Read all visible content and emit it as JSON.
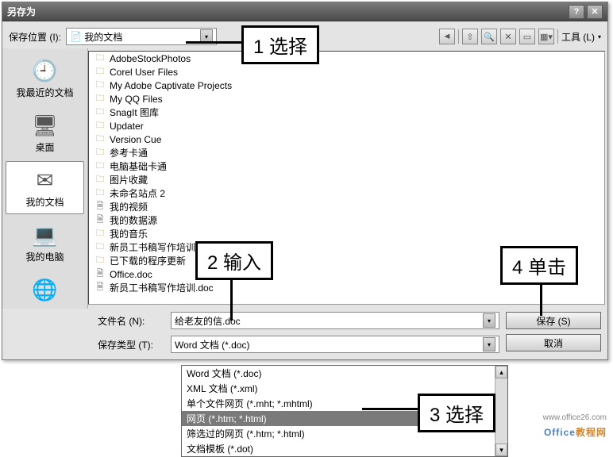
{
  "title": "另存为",
  "saveLocationLabel": "保存位置 (I):",
  "locationValue": "我的文档",
  "toolsLabel": "工具 (L)",
  "sidebar": {
    "items": [
      {
        "label": "我最近的文档"
      },
      {
        "label": "桌面"
      },
      {
        "label": "我的文档"
      },
      {
        "label": "我的电脑"
      },
      {
        "label": ""
      }
    ]
  },
  "files": [
    {
      "name": "AdobeStockPhotos",
      "type": "folder"
    },
    {
      "name": "Corel User Files",
      "type": "folder"
    },
    {
      "name": "My Adobe Captivate Projects",
      "type": "folder"
    },
    {
      "name": "My QQ Files",
      "type": "folder"
    },
    {
      "name": "SnagIt 图库",
      "type": "folder"
    },
    {
      "name": "Updater",
      "type": "folder"
    },
    {
      "name": "Version Cue",
      "type": "folder"
    },
    {
      "name": "参考卡通",
      "type": "folder"
    },
    {
      "name": "电脑基础卡通",
      "type": "folder"
    },
    {
      "name": "图片收藏",
      "type": "folder"
    },
    {
      "name": "未命名站点 2",
      "type": "folder"
    },
    {
      "name": "我的视频",
      "type": "file"
    },
    {
      "name": "我的数据源",
      "type": "file"
    },
    {
      "name": "我的音乐",
      "type": "folder"
    },
    {
      "name": "新员工书稿写作培训.files",
      "type": "folder"
    },
    {
      "name": "已下载的程序更新",
      "type": "folder"
    },
    {
      "name": "Office.doc",
      "type": "file"
    },
    {
      "name": "新员工书稿写作培训.doc",
      "type": "file"
    }
  ],
  "filenameLabel": "文件名 (N):",
  "filenameValue": "给老友的信.doc",
  "filetypeLabel": "保存类型 (T):",
  "filetypeValue": "Word 文档  (*.doc)",
  "saveBtn": "保存 (S)",
  "cancelBtn": "取消",
  "dropdown": [
    "Word 文档 (*.doc)",
    "XML 文档 (*.xml)",
    "单个文件网页 (*.mht; *.mhtml)",
    "网页 (*.htm; *.html)",
    "筛选过的网页 (*.htm; *.html)",
    "文档模板 (*.dot)"
  ],
  "callouts": {
    "c1": "1 选择",
    "c2": "2 输入",
    "c3": "3 选择",
    "c4": "4 单击"
  },
  "watermark": "Office",
  "watermark_suffix": "教程网",
  "watermark_url": "www.office26.com"
}
